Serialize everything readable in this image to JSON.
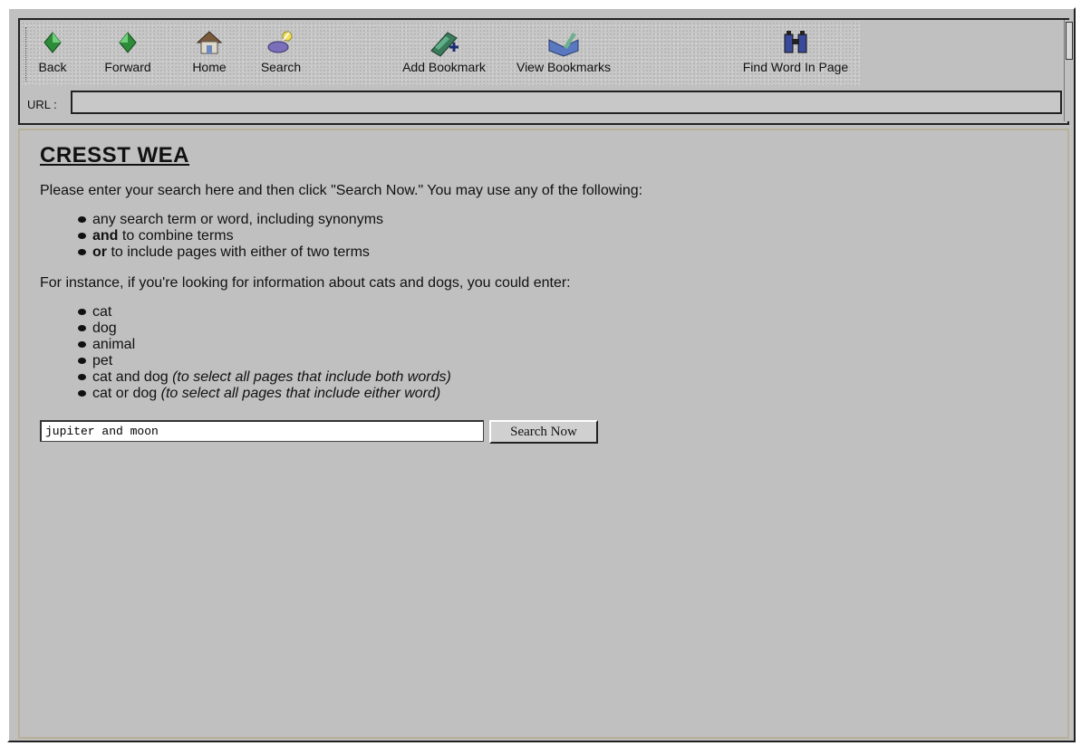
{
  "toolbar": {
    "buttons": [
      {
        "label": "Back",
        "icon": "back-arrow-icon"
      },
      {
        "label": "Forward",
        "icon": "forward-arrow-icon"
      },
      {
        "label": "Home",
        "icon": "home-icon"
      },
      {
        "label": "Search",
        "icon": "search-icon"
      },
      {
        "label": "Add Bookmark",
        "icon": "add-bookmark-icon"
      },
      {
        "label": "View Bookmarks",
        "icon": "view-bookmarks-icon"
      },
      {
        "label": "Find Word In Page",
        "icon": "binoculars-icon"
      }
    ],
    "url_label": "URL :",
    "url_value": ""
  },
  "page": {
    "title": "CRESST WEA",
    "intro": "Please enter your search here and then click \"Search Now.\" You may use any of the following:",
    "options": [
      {
        "bold": "",
        "text": "any search term or word, including synonyms"
      },
      {
        "bold": "and",
        "text": " to combine terms"
      },
      {
        "bold": "or",
        "text": " to include pages with either of two terms"
      }
    ],
    "instance_intro": "For instance, if you're looking for information about cats and dogs, you could enter:",
    "examples": [
      {
        "text": "cat",
        "note": ""
      },
      {
        "text": "dog",
        "note": ""
      },
      {
        "text": "animal",
        "note": ""
      },
      {
        "text": "pet",
        "note": ""
      },
      {
        "text": "cat and dog ",
        "note": "(to select all pages that include both words)"
      },
      {
        "text": "cat or dog ",
        "note": "(to select all pages that include either word)"
      }
    ],
    "search_value": "jupiter and moon",
    "search_button": "Search Now"
  },
  "colors": {
    "window_bg": "#c0c0c0",
    "back_forward": "#2e8b3a",
    "accent_blue": "#3050a0"
  }
}
